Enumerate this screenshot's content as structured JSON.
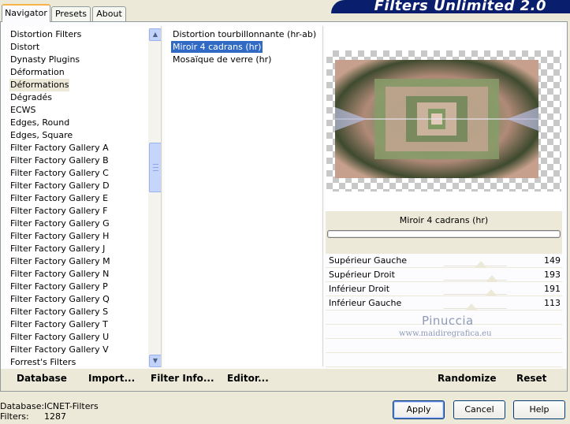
{
  "tabs": [
    {
      "label": "Navigator",
      "active": true
    },
    {
      "label": "Presets",
      "active": false
    },
    {
      "label": "About",
      "active": false
    }
  ],
  "banner": {
    "title": "Filters Unlimited 2.0"
  },
  "categories": {
    "selected_index": 4,
    "items": [
      "Distortion Filters",
      "Distort",
      "Dynasty Plugins",
      "Déformation",
      "Déformations",
      "Dégradés",
      "ECWS",
      "Edges, Round",
      "Edges, Square",
      "Filter Factory Gallery A",
      "Filter Factory Gallery B",
      "Filter Factory Gallery C",
      "Filter Factory Gallery D",
      "Filter Factory Gallery E",
      "Filter Factory Gallery F",
      "Filter Factory Gallery G",
      "Filter Factory Gallery H",
      "Filter Factory Gallery J",
      "Filter Factory Gallery M",
      "Filter Factory Gallery N",
      "Filter Factory Gallery P",
      "Filter Factory Gallery Q",
      "Filter Factory Gallery S",
      "Filter Factory Gallery T",
      "Filter Factory Gallery U",
      "Filter Factory Gallery V",
      "Forrest's Filters"
    ]
  },
  "filters": {
    "selected_index": 1,
    "items": [
      "Distortion tourbillonnante (hr-ab)",
      "Miroir 4 cadrans (hr)",
      "Mosaïque de verre (hr)"
    ]
  },
  "preview": {
    "filter_name": "Miroir 4 cadrans (hr)",
    "progress_fraction": 0
  },
  "parameters": [
    {
      "label": "Supérieur Gauche",
      "value": 149,
      "max": 255
    },
    {
      "label": "Supérieur Droit",
      "value": 193,
      "max": 255
    },
    {
      "label": "Inférieur Droit",
      "value": 191,
      "max": 255
    },
    {
      "label": "Inférieur Gauche",
      "value": 113,
      "max": 255
    }
  ],
  "watermark": {
    "line1": "Pinuccia",
    "line2": "www.maidiregrafica.eu"
  },
  "bottom_links": {
    "database": "Database",
    "import": "Import...",
    "filter_info": "Filter Info...",
    "editor": "Editor...",
    "randomize": "Randomize",
    "reset": "Reset"
  },
  "status": {
    "database_label": "Database:",
    "database_value": "ICNET-Filters",
    "filters_label": "Filters:",
    "filters_value": "1287"
  },
  "buttons": {
    "apply": "Apply",
    "cancel": "Cancel",
    "help": "Help"
  },
  "colors": {
    "selection": "#316ac5",
    "banner": "#0a1e6e",
    "window_bg": "#ece9d8"
  }
}
